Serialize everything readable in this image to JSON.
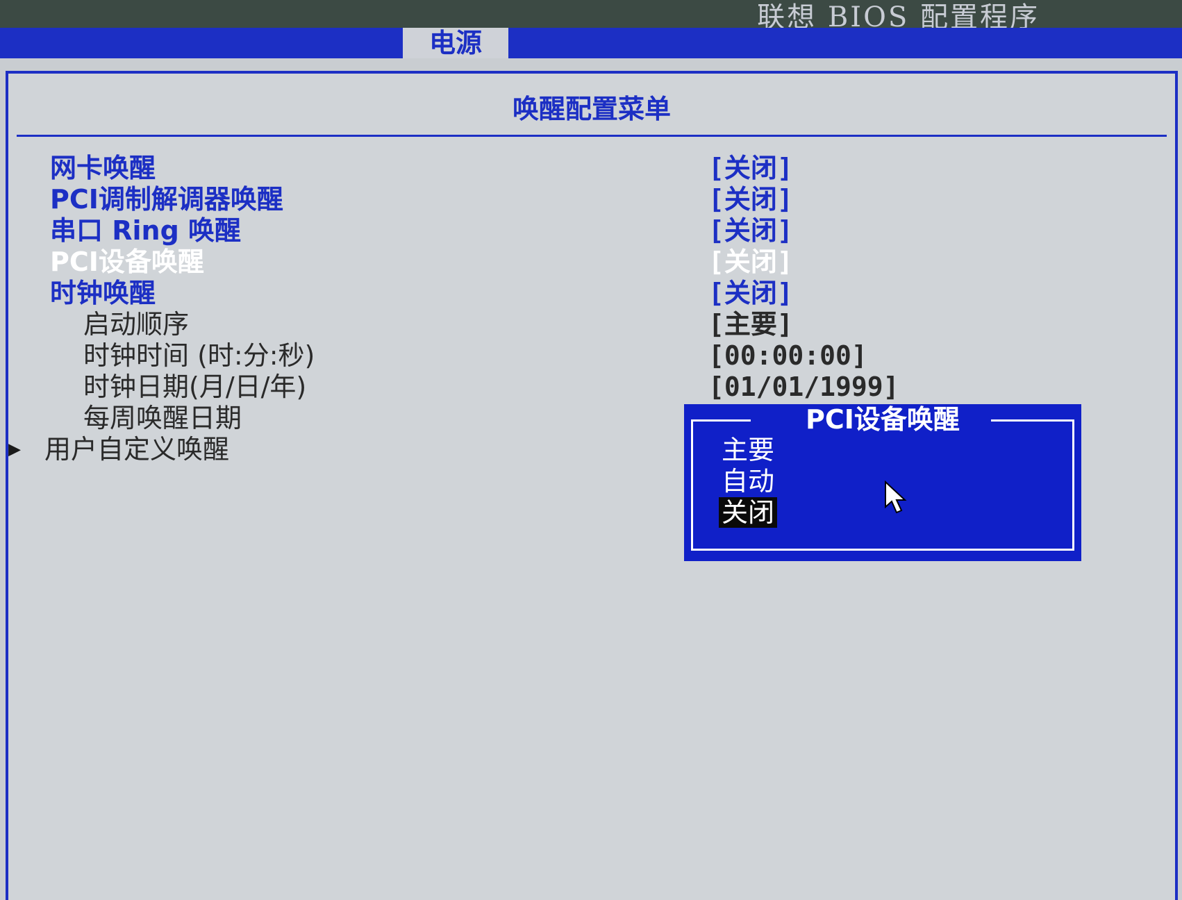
{
  "app_title": "联想 BIOS 配置程序",
  "active_tab": "电源",
  "menu_title": "唤醒配置菜单",
  "settings": [
    {
      "label": "网卡唤醒",
      "value": "[关闭]",
      "style": "blue"
    },
    {
      "label": "PCI调制解调器唤醒",
      "value": "[关闭]",
      "style": "blue"
    },
    {
      "label": "串口 Ring 唤醒",
      "value": "[关闭]",
      "style": "blue"
    },
    {
      "label": "PCI设备唤醒",
      "value": "[关闭]",
      "style": "white"
    },
    {
      "label": "时钟唤醒",
      "value": "[关闭]",
      "style": "blue"
    },
    {
      "label": "启动顺序",
      "value": "[主要]",
      "style": "dark"
    },
    {
      "label": "时钟时间 (时:分:秒)",
      "value": "[00:00:00]",
      "style": "dark"
    },
    {
      "label": "时钟日期(月/日/年)",
      "value": "[01/01/1999]",
      "style": "dark"
    },
    {
      "label": "每周唤醒日期",
      "value": "",
      "style": "dark"
    },
    {
      "label": "用户自定义唤醒",
      "value": "",
      "style": "dark"
    }
  ],
  "arrow_glyph": "▶",
  "popup": {
    "title": "PCI设备唤醒",
    "options": [
      "主要",
      "自动",
      "关闭"
    ],
    "selected": "关闭"
  },
  "colors": {
    "bios_blue": "#1c2fc4",
    "background": "#d0d4d8",
    "popup_blue": "#1020c8"
  }
}
